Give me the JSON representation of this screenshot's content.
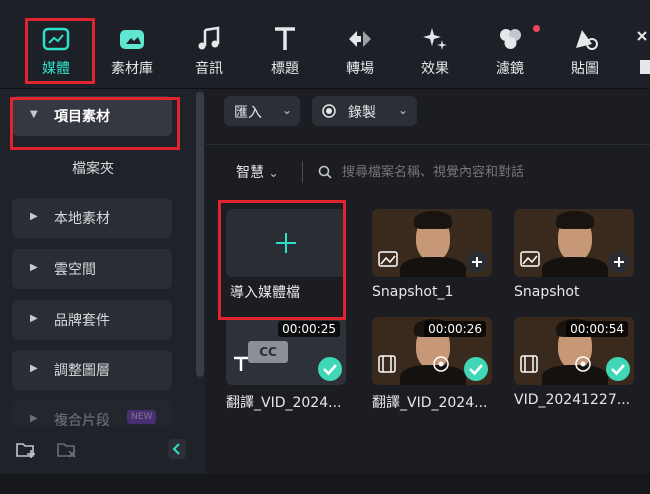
{
  "toolbar": {
    "tools": [
      {
        "label": "媒體",
        "icon": "media-icon",
        "active": true
      },
      {
        "label": "素材庫",
        "icon": "stock-library-icon"
      },
      {
        "label": "音訊",
        "icon": "music-note-icon"
      },
      {
        "label": "標題",
        "icon": "title-t-icon"
      },
      {
        "label": "轉場",
        "icon": "transition-icon"
      },
      {
        "label": "效果",
        "icon": "sparkle-effects-icon"
      },
      {
        "label": "濾鏡",
        "icon": "filter-circles-icon",
        "badge": "red-dot"
      },
      {
        "label": "貼圖",
        "icon": "sticker-icon"
      }
    ],
    "accent": "#2ee0c8"
  },
  "sidebar": {
    "items": [
      {
        "label": "項目素材",
        "selected": true
      },
      {
        "label": "檔案夾",
        "sub": true
      },
      {
        "label": "本地素材"
      },
      {
        "label": "雲空間"
      },
      {
        "label": "品牌套件"
      },
      {
        "label": "調整圖層"
      },
      {
        "label": "複合片段",
        "tag": "NEW"
      }
    ],
    "bottom_icons": [
      "add-folder-icon",
      "remove-folder-icon",
      "collapse-panel-icon"
    ]
  },
  "main": {
    "import_label": "匯入",
    "record_label": "錄製",
    "smart_label": "智慧",
    "search_placeholder": "搜尋檔案名稱、視覺內容和對話",
    "import_tile_label": "導入媒體檔",
    "items": [
      {
        "caption": "Snapshot_1",
        "type": "image"
      },
      {
        "caption": "Snapshot",
        "type": "image"
      },
      {
        "caption": "翻譯_VID_2024...",
        "duration": "00:00:25",
        "type": "subtitle"
      },
      {
        "caption": "翻譯_VID_2024...",
        "duration": "00:00:26",
        "type": "video"
      },
      {
        "caption": "VID_20241227...",
        "duration": "00:00:54",
        "type": "video"
      }
    ]
  },
  "colors": {
    "highlight": "#e0232e",
    "check": "#3fd7b6"
  }
}
